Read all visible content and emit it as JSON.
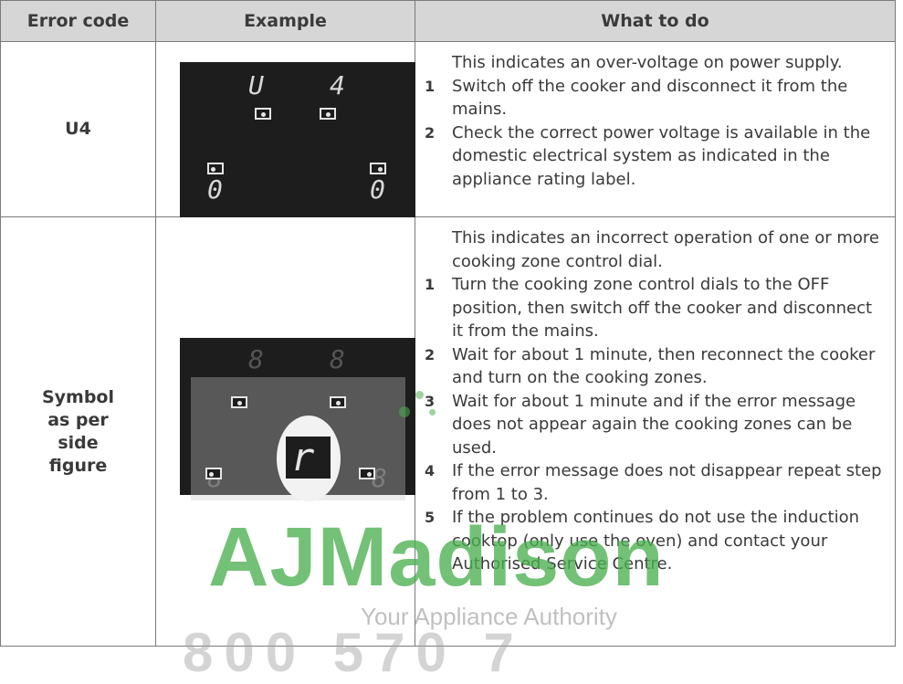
{
  "table": {
    "headers": [
      "Error code",
      "Example",
      "What to do"
    ],
    "rows": [
      {
        "code": [
          "U4"
        ],
        "display_digits": {
          "top_left": "U",
          "top_right": "4",
          "bottom_left": "0",
          "bottom_right": "0"
        },
        "intro": "This indicates an over-voltage on power supply.",
        "steps": [
          {
            "n": "1",
            "text": "Switch off the cooker and disconnect it from the mains."
          },
          {
            "n": "2",
            "text": "Check the correct power voltage is available in the domestic electrical system as indicated in the appliance rating label."
          }
        ]
      },
      {
        "code": [
          "Symbol",
          "as per",
          "side",
          "figure"
        ],
        "display_digits": {
          "top_left": "8",
          "top_right": "8",
          "bottom_left": "8",
          "bottom_right": "8",
          "highlight": "r"
        },
        "intro": "This indicates an incorrect operation of one or more cooking zone control dial.",
        "steps": [
          {
            "n": "1",
            "text": "Turn the cooking zone control dials to the OFF position, then switch off the cooker and disconnect it from the mains."
          },
          {
            "n": "2",
            "text": "Wait for about 1 minute, then reconnect the cooker and turn on the cooking zones."
          },
          {
            "n": "3",
            "text": "Wait for about 1 minute and if the error message does not appear again the cooking zones can be used."
          },
          {
            "n": "4",
            "text": "If the error message does not disappear repeat step from 1 to 3."
          },
          {
            "n": "5",
            "text": "If the problem continues do not use the induction cooktop (only use the oven) and contact your Authorised Service Centre."
          }
        ]
      }
    ]
  },
  "watermark": {
    "brand": "AJMadison",
    "tagline": "Your Appliance Authority",
    "phone": "800 570 7"
  }
}
